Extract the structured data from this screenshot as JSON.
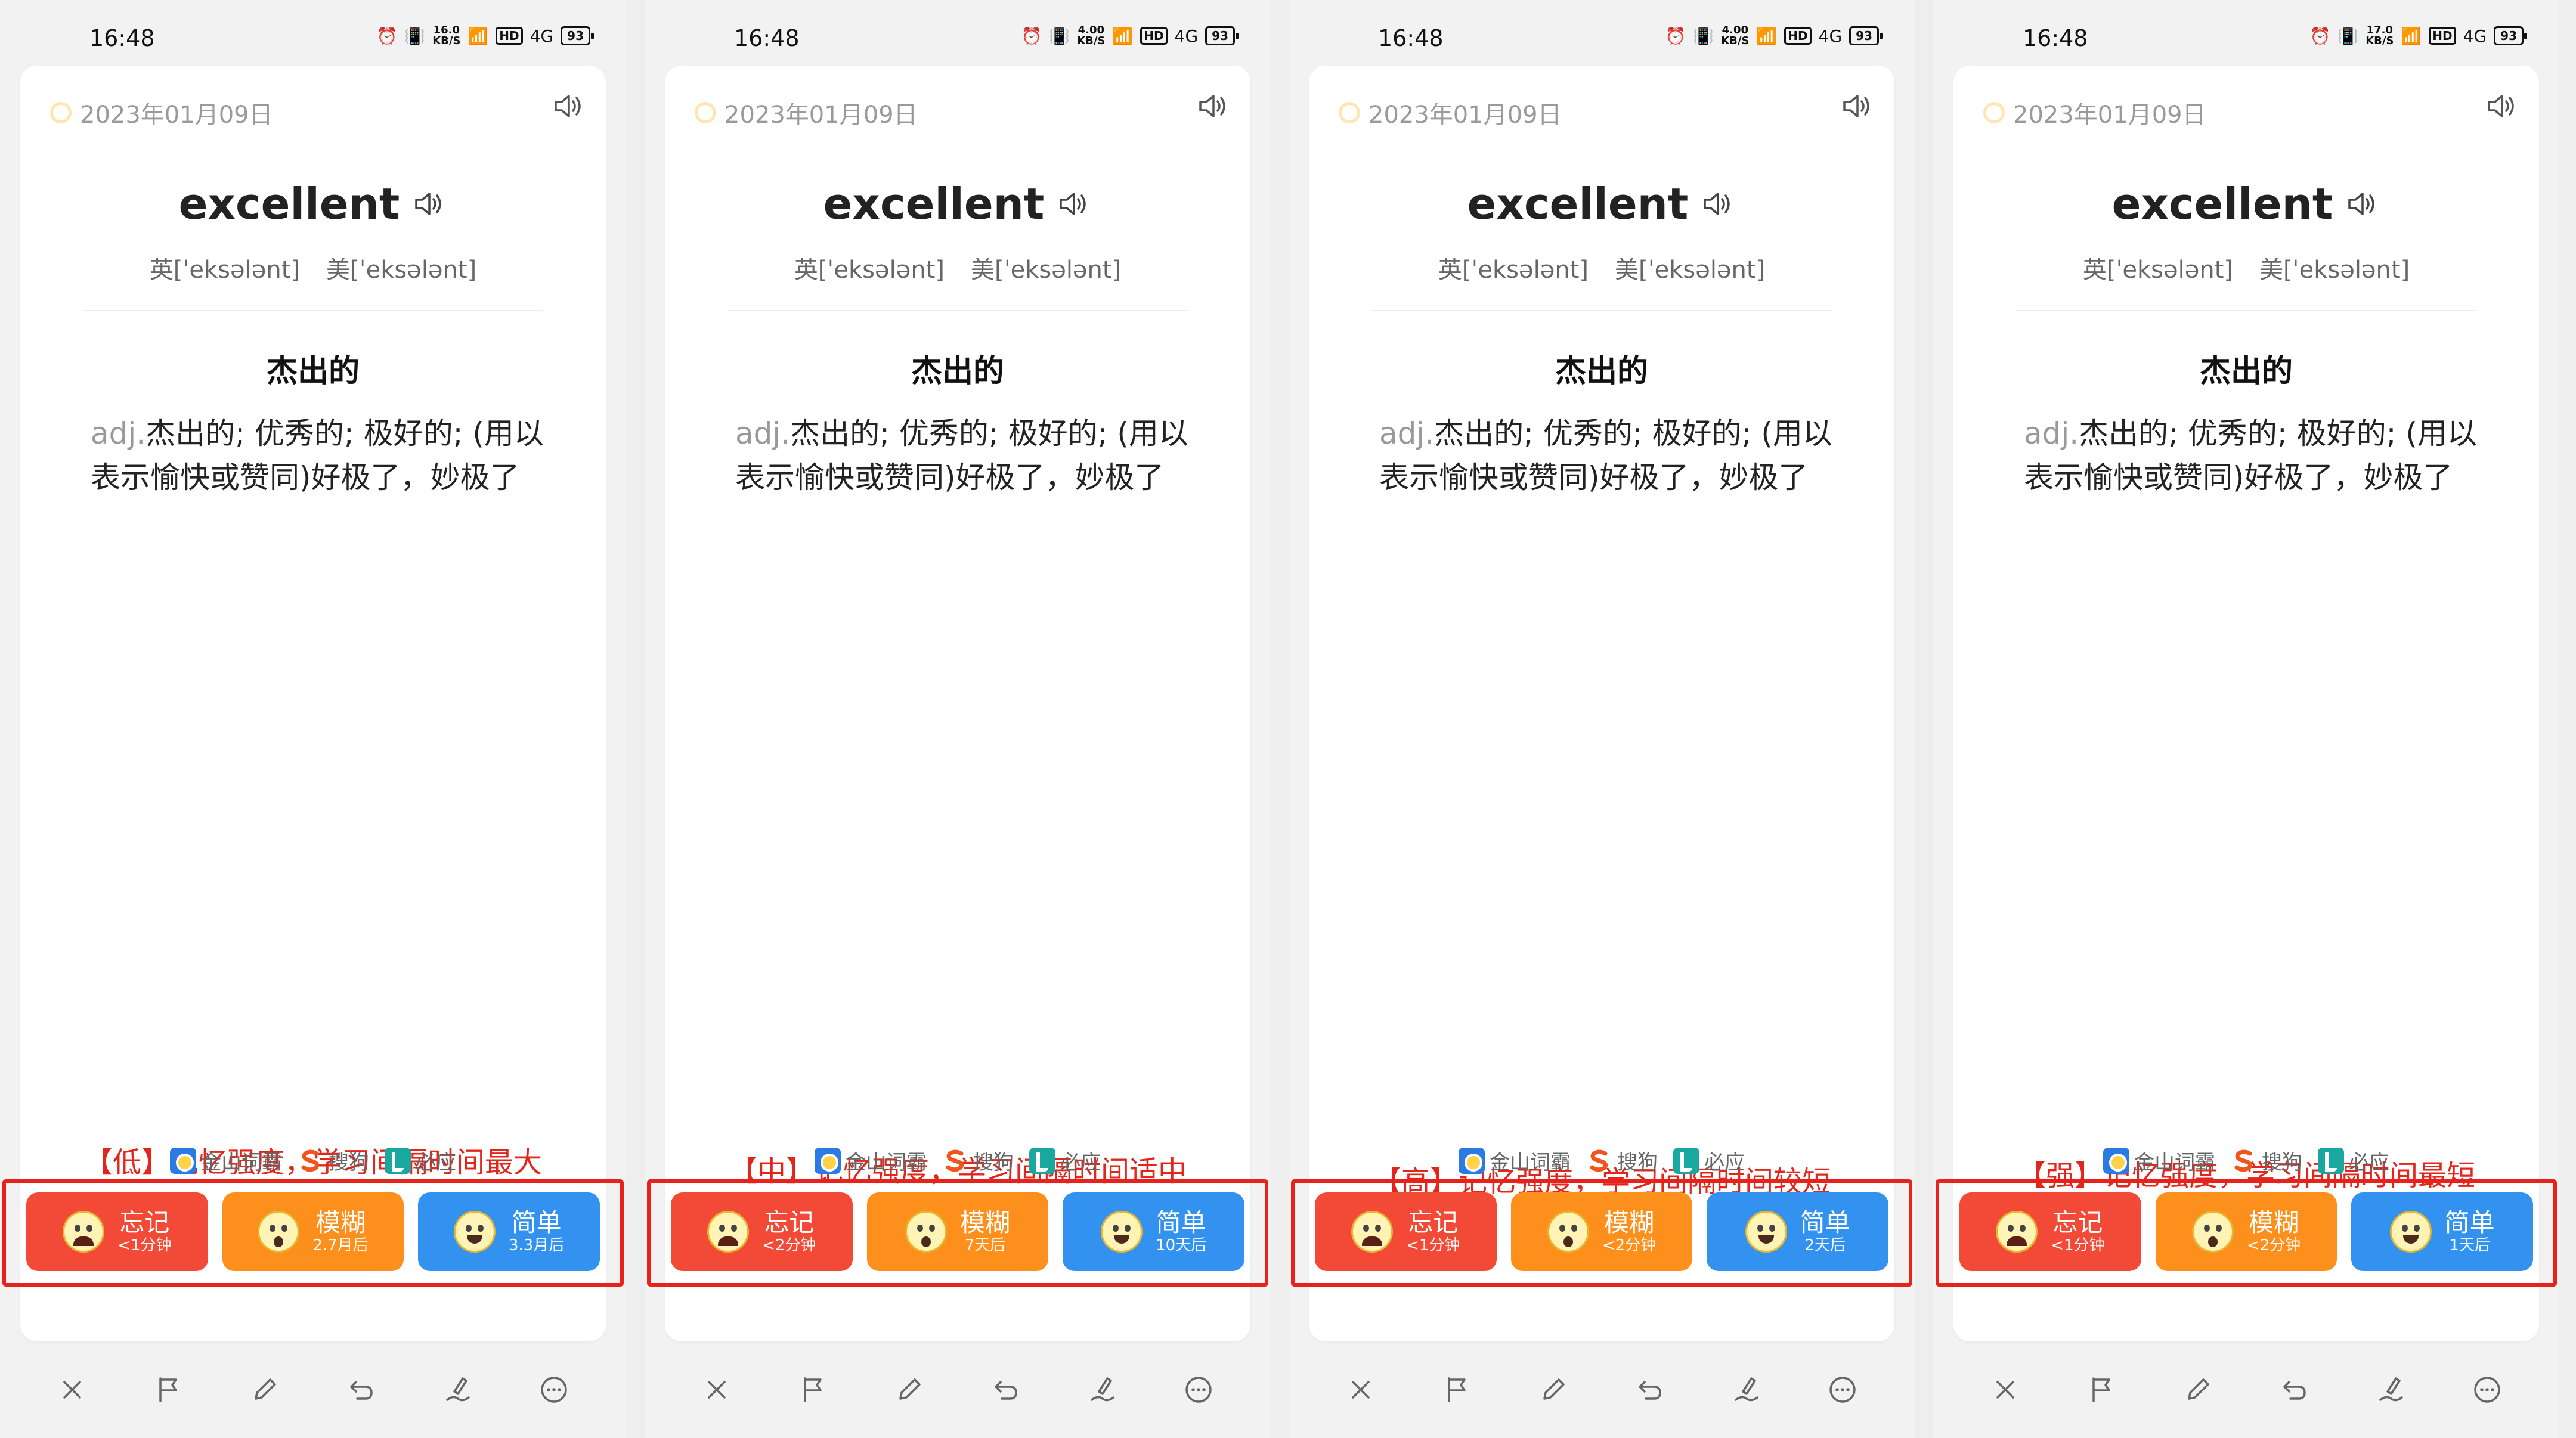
{
  "statusbar": {
    "time": "16:48",
    "battery": "93",
    "net_unit": "KB/S",
    "hd": "HD",
    "signal": "4G"
  },
  "card": {
    "date": "2023年01月09日",
    "word": "excellent",
    "phonetic_uk": "英[ˈeksələnt]",
    "phonetic_us": "美[ˈeksələnt]",
    "meaning_title": "杰出的",
    "definition_pos": "adj.",
    "definition_text": "杰出的; 优秀的; 极好的; (用以表示愉快或赞同)好极了，妙极了"
  },
  "sources": [
    {
      "name": "金山词霸",
      "icon": "jinshan-logo"
    },
    {
      "name": "搜狗",
      "icon": "sogou-logo"
    },
    {
      "name": "必应",
      "icon": "biying-logo"
    }
  ],
  "toolbar": [
    "close-icon",
    "flag-icon",
    "edit-icon",
    "undo-icon",
    "handwrite-icon",
    "more-icon"
  ],
  "colors": {
    "forget": "#f24a36",
    "fuzzy": "#fd901d",
    "easy": "#3392ef",
    "note": "#e3261c",
    "frame": "#e8211b"
  },
  "screens": [
    {
      "net_speed": "16.0",
      "note": "【低】记忆强度，学习间隔时间最大",
      "buttons": [
        {
          "label": "忘记",
          "sub": "<1分钟"
        },
        {
          "label": "模糊",
          "sub": "2.7月后"
        },
        {
          "label": "简单",
          "sub": "3.3月后"
        }
      ]
    },
    {
      "net_speed": "4.00",
      "note": "【中】记忆强度，学习间隔时间适中",
      "buttons": [
        {
          "label": "忘记",
          "sub": "<2分钟"
        },
        {
          "label": "模糊",
          "sub": "7天后"
        },
        {
          "label": "简单",
          "sub": "10天后"
        }
      ]
    },
    {
      "net_speed": "4.00",
      "note": "【高】记忆强度，学习间隔时间较短",
      "buttons": [
        {
          "label": "忘记",
          "sub": "<1分钟"
        },
        {
          "label": "模糊",
          "sub": "<2分钟"
        },
        {
          "label": "简单",
          "sub": "2天后"
        }
      ]
    },
    {
      "net_speed": "17.0",
      "note": "【强】记忆强度，学习间隔时间最短",
      "buttons": [
        {
          "label": "忘记",
          "sub": "<1分钟"
        },
        {
          "label": "模糊",
          "sub": "<2分钟"
        },
        {
          "label": "简单",
          "sub": "1天后"
        }
      ]
    }
  ]
}
